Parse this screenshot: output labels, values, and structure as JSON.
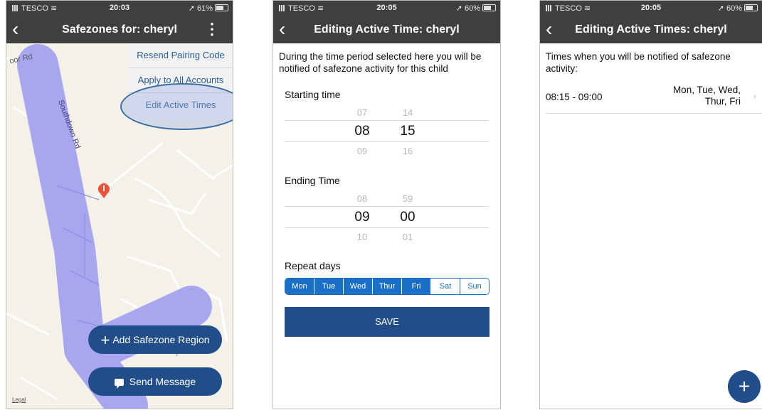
{
  "phone1": {
    "status": {
      "carrier": "TESCO",
      "time": "20:03",
      "battery": "61%"
    },
    "nav": {
      "title": "Safezones for: cheryl",
      "back_icon": "‹",
      "menu_icon": "⋮"
    },
    "dropdown": {
      "items": [
        "Resend Pairing Code",
        "Apply to All Accounts",
        "Edit Active Times"
      ]
    },
    "map": {
      "road_label": "Southdown Rd",
      "road_label_2": "oor Rd",
      "legal": "Legal"
    },
    "buttons": {
      "add": "Add Safezone Region",
      "add_icon": "+",
      "send": "Send Message"
    }
  },
  "phone2": {
    "status": {
      "carrier": "TESCO",
      "time": "20:05",
      "battery": "60%"
    },
    "nav": {
      "title": "Editing Active Time: cheryl",
      "back_icon": "‹"
    },
    "intro": "During the time period selected here you will be notified of safezone activity for this child",
    "start": {
      "label": "Starting time",
      "hour_prev": "07",
      "hour": "08",
      "hour_next": "09",
      "min_prev": "14",
      "min": "15",
      "min_next": "16"
    },
    "end": {
      "label": "Ending Time",
      "hour_prev": "08",
      "hour": "09",
      "hour_next": "10",
      "min_prev": "59",
      "min": "00",
      "min_next": "01"
    },
    "repeat": {
      "label": "Repeat days",
      "days": [
        "Mon",
        "Tue",
        "Wed",
        "Thur",
        "Fri",
        "Sat",
        "Sun"
      ]
    },
    "save": "SAVE"
  },
  "phone3": {
    "status": {
      "carrier": "TESCO",
      "time": "20:05",
      "battery": "60%"
    },
    "nav": {
      "title": "Editing Active Times: cheryl",
      "back_icon": "‹"
    },
    "intro": "Times when you will be notified of safezone activity:",
    "row": {
      "time": "08:15 - 09:00",
      "days_line1": "Mon, Tue, Wed,",
      "days_line2": "Thur, Fri",
      "chevron": "›"
    },
    "add_icon": "+"
  },
  "colors": {
    "accent": "#214e89",
    "segment": "#1a6fc7",
    "navbar": "#3f3f3f",
    "route": "#a9a6f0"
  }
}
